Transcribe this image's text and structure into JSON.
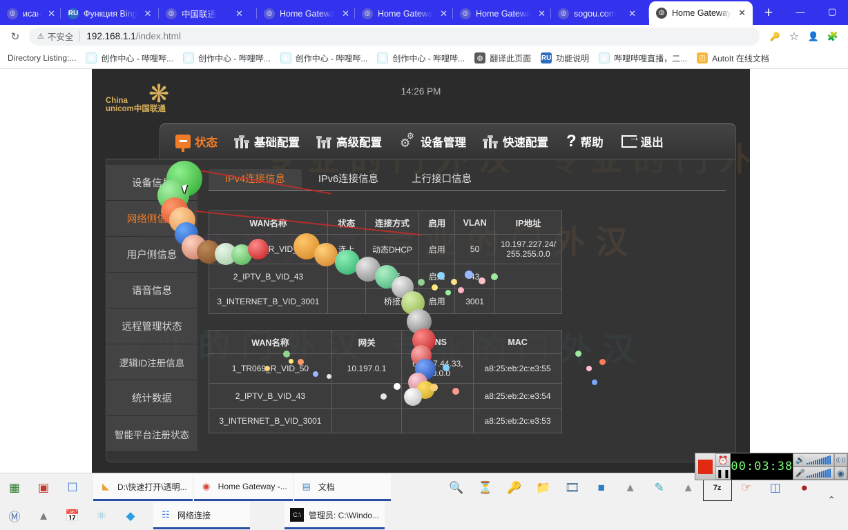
{
  "browser": {
    "tabs": [
      {
        "title": "исание ф",
        "favicon": "globe-icon",
        "active": false
      },
      {
        "title": "Функция Bing",
        "favicon": "ru-icon",
        "active": false
      },
      {
        "title": "中国联通",
        "favicon": "globe-icon",
        "active": false
      },
      {
        "title": "Home Gateway",
        "favicon": "globe-icon",
        "active": false
      },
      {
        "title": "Home Gateway",
        "favicon": "globe-icon",
        "active": false
      },
      {
        "title": "Home Gateway",
        "favicon": "globe-icon",
        "active": false
      },
      {
        "title": "sogou.com",
        "favicon": "globe-icon",
        "active": false
      },
      {
        "title": "Home Gateway",
        "favicon": "globe-icon",
        "active": true
      }
    ],
    "new_tab_label": "+",
    "close_label": "✕",
    "window_controls": {
      "minimize": "—",
      "maximize": "▢",
      "close": "✕"
    },
    "toolbar": {
      "reload_icon": "↻",
      "security_label": "不安全",
      "security_icon": "⚠",
      "url_host": "192.168.1.1",
      "url_path": "/index.html",
      "key_icon": "🔑",
      "star_icon": "☆",
      "profile_icon": "👤",
      "extensions_icon": "🧩"
    },
    "bookmarks": [
      {
        "label": "Directory Listing:...",
        "icon": "none"
      },
      {
        "label": "创作中心 - 哔哩哔...",
        "icon": "bili-icon"
      },
      {
        "label": "创作中心 - 哔哩哔...",
        "icon": "bili-icon"
      },
      {
        "label": "创作中心 - 哔哩哔...",
        "icon": "bili-icon"
      },
      {
        "label": "创作中心 - 哔哩哔...",
        "icon": "bili-icon"
      },
      {
        "label": "翻译此页面",
        "icon": "globe-icon"
      },
      {
        "label": "功能说明",
        "icon": "ru-icon"
      },
      {
        "label": "哔哩哔哩直播，二...",
        "icon": "bili-icon"
      },
      {
        "label": "AutoIt 在线文档",
        "icon": "autoit-icon"
      }
    ]
  },
  "router": {
    "brand_line1": "China",
    "brand_line2": "unicom中国联通",
    "clock": "14:26 PM",
    "watermark_text": "专业的门外汉",
    "nav": [
      {
        "label": "状态",
        "icon": "monitor-icon",
        "active": true
      },
      {
        "label": "基础配置",
        "icon": "sliders-icon",
        "active": false
      },
      {
        "label": "高级配置",
        "icon": "sliders-icon",
        "active": false
      },
      {
        "label": "设备管理",
        "icon": "gears-icon",
        "active": false
      },
      {
        "label": "快速配置",
        "icon": "sliders-icon",
        "active": false
      },
      {
        "label": "帮助",
        "icon": "question-icon",
        "active": false
      },
      {
        "label": "退出",
        "icon": "exit-icon",
        "active": false
      }
    ],
    "sidebar": [
      {
        "label": "设备信息",
        "active": false
      },
      {
        "label": "网络侧信息",
        "active": true
      },
      {
        "label": "用户侧信息",
        "active": false
      },
      {
        "label": "语音信息",
        "active": false
      },
      {
        "label": "远程管理状态",
        "active": false
      },
      {
        "label": "逻辑ID注册信息",
        "active": false
      },
      {
        "label": "统计数据",
        "active": false
      },
      {
        "label": "智能平台注册状态",
        "active": false
      }
    ],
    "content_tabs": [
      {
        "label": "IPv4连接信息",
        "active": true
      },
      {
        "label": "IPv6连接信息",
        "active": false
      },
      {
        "label": "上行接口信息",
        "active": false
      }
    ],
    "table1": {
      "headers": [
        "WAN名称",
        "状态",
        "连接方式",
        "启用",
        "VLAN",
        "IP地址"
      ],
      "rows": [
        [
          "1_TR069_R_VID_50",
          "连上",
          "动态DHCP",
          "启用",
          "50",
          "10.197.227.24/ 255.255.0.0"
        ],
        [
          "2_IPTV_B_VID_43",
          "",
          "桥接",
          "启用",
          "43",
          ""
        ],
        [
          "3_INTERNET_B_VID_3001",
          "",
          "桥接",
          "启用",
          "3001",
          ""
        ]
      ]
    },
    "table2": {
      "headers": [
        "WAN名称",
        "网关",
        "DNS",
        "MAC"
      ],
      "rows": [
        [
          "1_TR069_R_VID_50",
          "10.197.0.1",
          "60.217.44.33, 0.0.0.0",
          "a8:25:eb:2c:e3:55"
        ],
        [
          "2_IPTV_B_VID_43",
          "",
          "",
          "a8:25:eb:2c:e3:54"
        ],
        [
          "3_INTERNET_B_VID_3001",
          "",
          "",
          "a8:25:eb:2c:e3:53"
        ]
      ]
    }
  },
  "recorder": {
    "stop_label": "",
    "clock_icon": "⏰",
    "pause_icon": "❚❚",
    "time": "00:03:38",
    "speaker_icon": "🔊",
    "mic_icon": "🎤",
    "wifi_icon": "((·))",
    "cam_icon": "◉"
  },
  "taskbar": {
    "row1_icons": [
      "window-icon",
      "stamp-icon",
      "transfer-icon"
    ],
    "row2_icons": [
      "r-icon",
      "shield-icon",
      "calendar-321-icon"
    ],
    "row1_tasks": [
      {
        "label": "D:\\快速打开\\透明...",
        "icon": "folder-icon"
      },
      {
        "label": "Home Gateway -...",
        "icon": "chrome-icon"
      },
      {
        "label": "文档",
        "icon": "doc-icon"
      }
    ],
    "row2_tasks": [
      {
        "label": "网络连接",
        "icon": "network-icon"
      },
      {
        "label": "管理员: C:\\Windo...",
        "icon": "cmd-icon"
      }
    ],
    "tray_icons": [
      "magnifier-icon",
      "hourglass-icon",
      "key-icon",
      "folder-icon",
      "film-icon",
      "blue-app-icon",
      "shield-icon",
      "notepad-icon",
      "shield-icon",
      "7z-icon",
      "pointer-icon",
      "panel-icon",
      "record-icon"
    ],
    "show_hidden_icon": "⌃"
  }
}
